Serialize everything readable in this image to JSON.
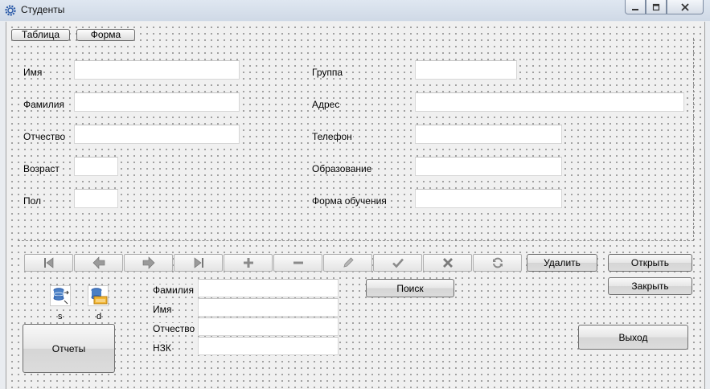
{
  "window": {
    "title": "Студенты"
  },
  "tabs": {
    "table": "Таблица",
    "form": "Форма"
  },
  "form": {
    "name": "Имя",
    "surname": "Фамилия",
    "patronymic": "Отчество",
    "age": "Возраст",
    "gender": "Пол",
    "group": "Группа",
    "address": "Адрес",
    "phone": "Телефон",
    "education": "Образование",
    "study_form": "Форма обучения"
  },
  "navigator": {
    "buttons": [
      "first-icon",
      "prior-icon",
      "next-icon",
      "last-icon",
      "insert-icon",
      "delete-icon",
      "edit-icon",
      "post-icon",
      "cancel-icon",
      "refresh-icon"
    ]
  },
  "actions": {
    "delete": "Удалить",
    "open": "Открыть",
    "close": "Закрыть",
    "search": "Поиск",
    "exit": "Выход",
    "reports": "Отчеты"
  },
  "components": {
    "s_label": "s",
    "d_label": "d"
  },
  "search": {
    "surname": "Фамилия",
    "name": "Имя",
    "patronymic": "Отчество",
    "record_book": "НЗК"
  }
}
